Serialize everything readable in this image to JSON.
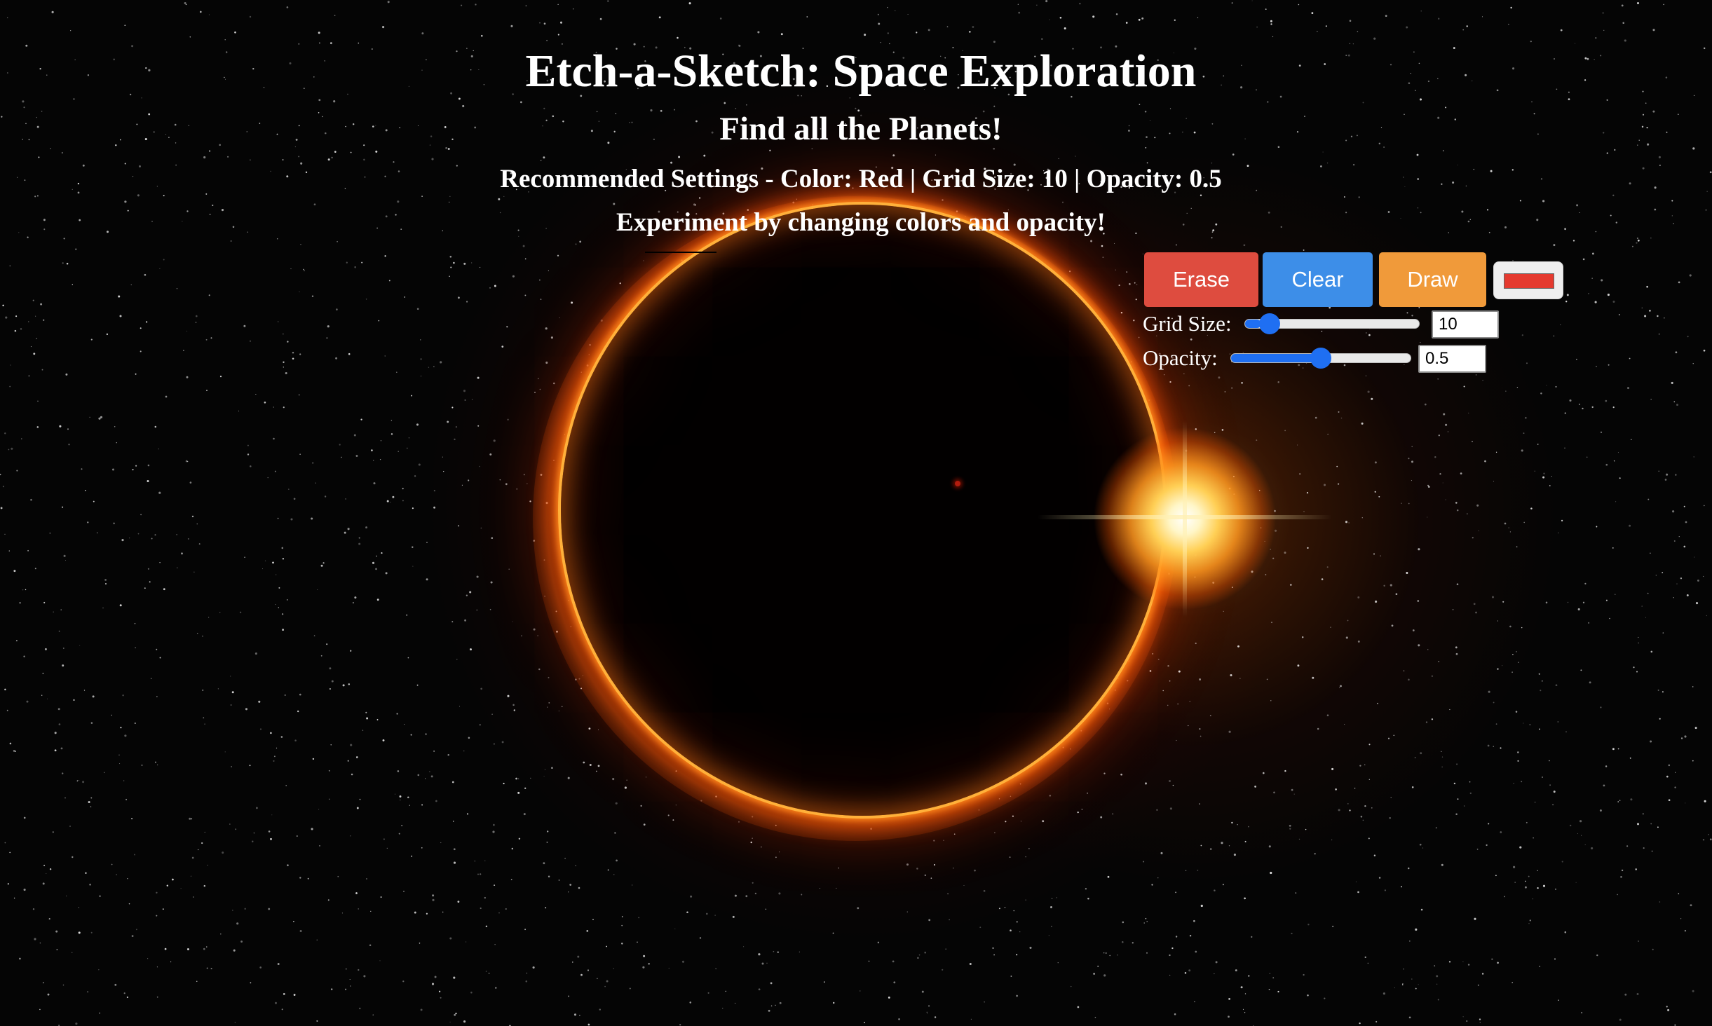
{
  "page": {
    "title": "Etch-a-Sketch: Space Exploration",
    "subtitle": "Find all the Planets!",
    "recommended": "Recommended Settings - Color: Red | Grid Size: 10 | Opacity: 0.5",
    "experiment": "Experiment by changing colors and opacity!"
  },
  "controls": {
    "erase_label": "Erase",
    "clear_label": "Clear",
    "draw_label": "Draw",
    "color_value": "#e53a2f",
    "grid_size_label": "Grid Size:",
    "grid_size_value": "10",
    "grid_size_min": 1,
    "grid_size_max": 100,
    "opacity_label": "Opacity:",
    "opacity_value": "0.5",
    "opacity_min": 0,
    "opacity_max": 1
  },
  "colors": {
    "erase": "#de4c3f",
    "clear": "#3d8ee8",
    "draw": "#f09a3a",
    "slider_accent": "#1f6ff2",
    "background": "#050505"
  },
  "background_image": "solar-eclipse-starfield"
}
